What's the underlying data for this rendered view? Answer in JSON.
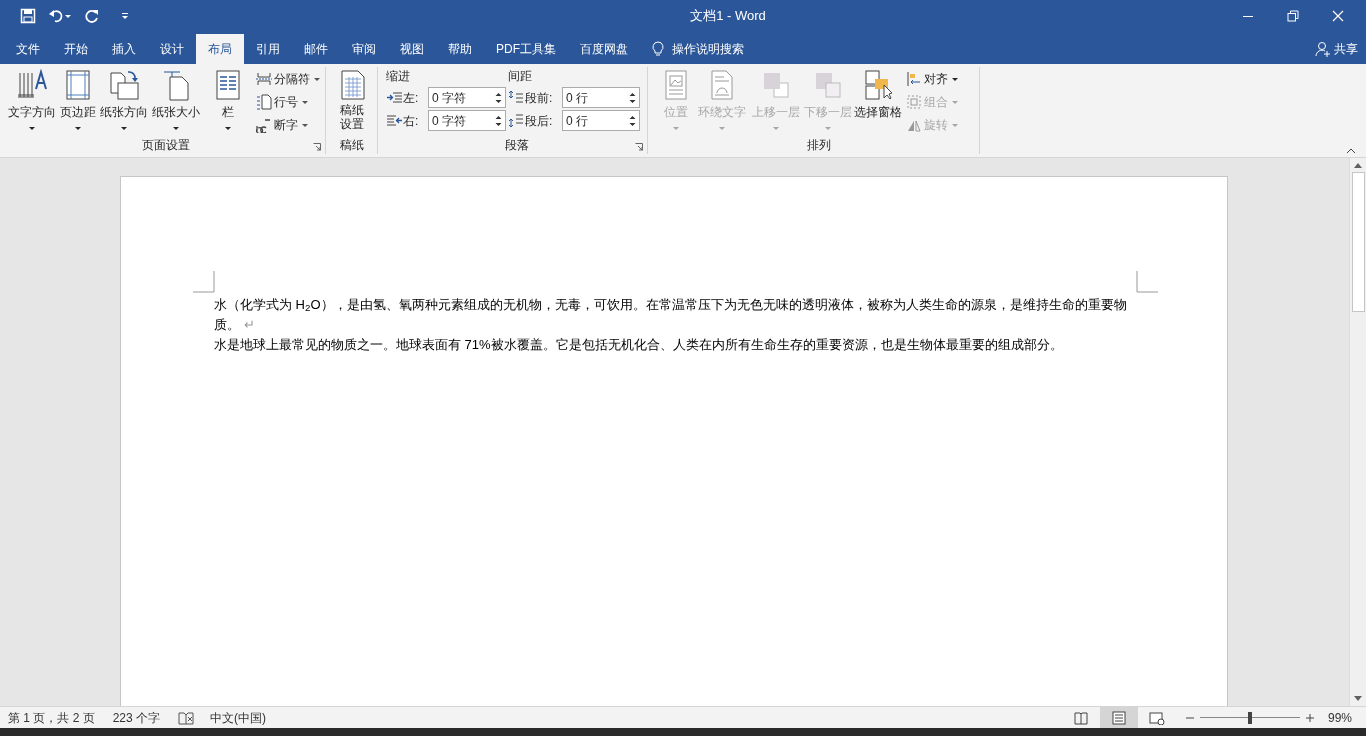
{
  "window": {
    "title": "文档1  -  Word"
  },
  "tabs": [
    {
      "label": "文件",
      "selected": false
    },
    {
      "label": "开始",
      "selected": false
    },
    {
      "label": "插入",
      "selected": false
    },
    {
      "label": "设计",
      "selected": false
    },
    {
      "label": "布局",
      "selected": true
    },
    {
      "label": "引用",
      "selected": false
    },
    {
      "label": "邮件",
      "selected": false
    },
    {
      "label": "审阅",
      "selected": false
    },
    {
      "label": "视图",
      "selected": false
    },
    {
      "label": "帮助",
      "selected": false
    },
    {
      "label": "PDF工具集",
      "selected": false
    },
    {
      "label": "百度网盘",
      "selected": false
    }
  ],
  "tell_me": "操作说明搜索",
  "share": "共享",
  "ribbon": {
    "page_setup": {
      "label": "页面设置",
      "large_buttons": [
        "文字方向",
        "页边距",
        "纸张方向",
        "纸张大小",
        "栏"
      ],
      "small_buttons": [
        "分隔符",
        "行号",
        "断字"
      ]
    },
    "manuscript": {
      "label": "稿纸",
      "button_lines": [
        "稿纸",
        "设置"
      ]
    },
    "paragraph": {
      "label": "段落",
      "indent_label": "缩进",
      "spacing_label": "间距",
      "indent": [
        {
          "label": "左:",
          "value": "0 字符"
        },
        {
          "label": "右:",
          "value": "0 字符"
        }
      ],
      "spacing": [
        {
          "label": "段前:",
          "value": "0 行"
        },
        {
          "label": "段后:",
          "value": "0 行"
        }
      ]
    },
    "arrange": {
      "label": "排列",
      "large_buttons": [
        {
          "label": "位置",
          "disabled": true
        },
        {
          "label": "环绕文字",
          "disabled": true
        },
        {
          "label": "上移一层",
          "disabled": true
        },
        {
          "label": "下移一层",
          "disabled": true
        },
        {
          "label": "选择窗格",
          "disabled": false
        }
      ],
      "small_buttons": [
        {
          "label": "对齐",
          "disabled": false
        },
        {
          "label": "组合",
          "disabled": true
        },
        {
          "label": "旋转",
          "disabled": true
        }
      ]
    }
  },
  "document": {
    "paragraphs": [
      {
        "text": "水（化学式为 H$_{2}$O），是由氢、氧两种元素组成的无机物，无毒，可饮用。在常温常压下为无色无味的透明液体，被称为人类生命的源泉，是维持生命的重要物质。",
        "mark": "↵"
      },
      {
        "text": "水是地球上最常见的物质之一。地球表面有 71%被水覆盖。它是包括无机化合、人类在内所有生命生存的重要资源，也是生物体最重要的组成部分。"
      }
    ]
  },
  "status_bar": {
    "page": "第 1 页，共 2 页",
    "words": "223 个字",
    "language": "中文(中国)",
    "views": [
      {
        "kind": "read",
        "selected": false
      },
      {
        "kind": "print",
        "selected": true
      },
      {
        "kind": "web",
        "selected": false
      }
    ],
    "zoom": {
      "level": 0.5,
      "reading": "99%"
    }
  }
}
